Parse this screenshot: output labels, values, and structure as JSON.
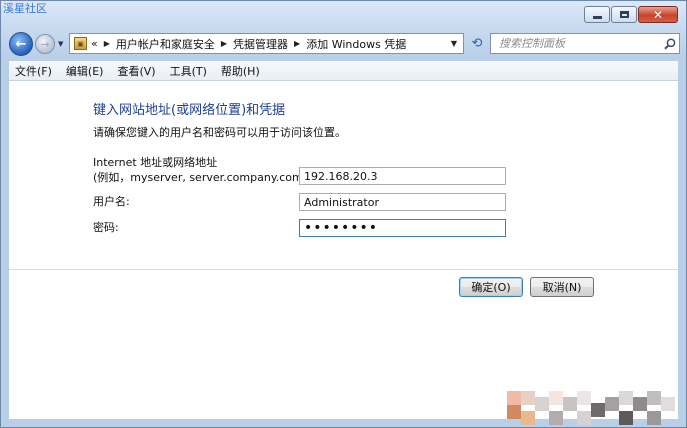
{
  "watermark": "溪星社区",
  "nav": {
    "breadcrumb_prefix": "«",
    "breadcrumbs": [
      "用户帐户和家庭安全",
      "凭据管理器",
      "添加 Windows 凭据"
    ]
  },
  "search": {
    "placeholder": "搜索控制面板"
  },
  "menu": [
    "文件(F)",
    "编辑(E)",
    "查看(V)",
    "工具(T)",
    "帮助(H)"
  ],
  "form": {
    "heading": "键入网站地址(或网络位置)和凭据",
    "subtitle": "请确保您键入的用户名和密码可以用于访问该位置。",
    "address_label_line1": "Internet 地址或网络地址",
    "address_label_line2": "(例如，myserver, server.company.com):",
    "address_value": "192.168.20.3",
    "username_label": "用户名:",
    "username_value": "Administrator",
    "password_label": "密码:",
    "password_value": "Password"
  },
  "buttons": {
    "ok": "确定(O)",
    "cancel": "取消(N)"
  }
}
